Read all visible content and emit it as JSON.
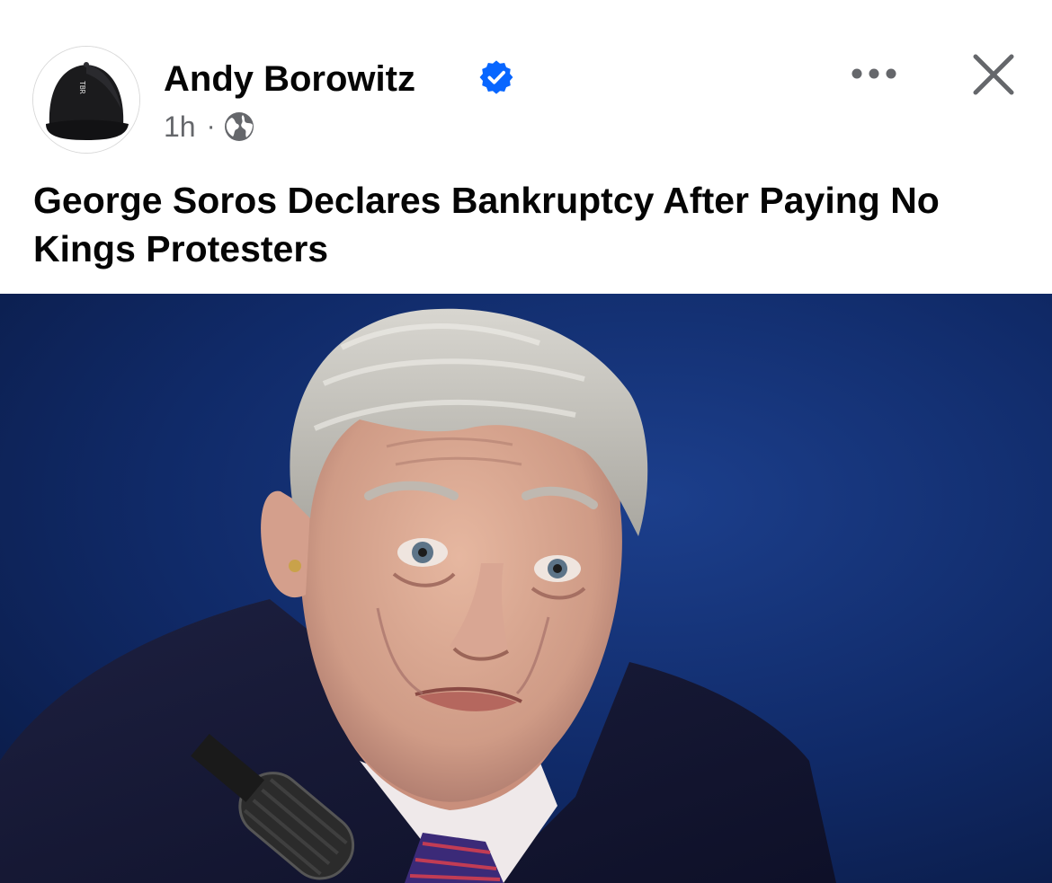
{
  "post": {
    "author": {
      "name": "Andy Borowitz",
      "verified": true,
      "avatar_icon": "black-baseball-cap"
    },
    "timestamp": "1h",
    "separator": "·",
    "audience_icon": "globe-icon",
    "headline": "George Soros Declares Bankruptcy After Paying No Kings Protesters",
    "actions": {
      "more_icon": "ellipsis-icon",
      "close_icon": "close-icon"
    },
    "image": {
      "subject": "photo of an elderly man speaking into a microphone",
      "background_color": "#0f2a66"
    }
  },
  "colors": {
    "text_primary": "#050505",
    "text_secondary": "#65676b",
    "verified_blue": "#0866ff"
  }
}
